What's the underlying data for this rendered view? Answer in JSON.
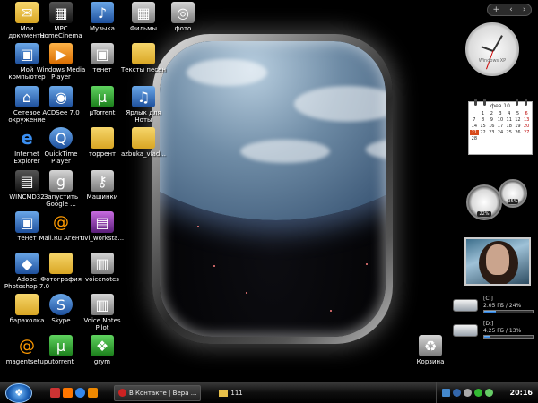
{
  "desktop": {
    "icons": [
      {
        "label": "Мои документы",
        "icon": "my-documents-icon"
      },
      {
        "label": "MPC HomeCinema",
        "icon": "mpc-icon"
      },
      {
        "label": "Музыка",
        "icon": "music-folder-icon"
      },
      {
        "label": "Фильмы",
        "icon": "films-icon"
      },
      {
        "label": "фото",
        "icon": "photo-icon"
      },
      {
        "label": "Мой компьютер",
        "icon": "my-computer-icon"
      },
      {
        "label": "Windows Media Player",
        "icon": "wmp-icon"
      },
      {
        "label": "тенет",
        "icon": "tenet-icon"
      },
      {
        "label": "Тексты песен",
        "icon": "folder-icon"
      },
      {
        "label": "Сетевое окружение",
        "icon": "network-icon"
      },
      {
        "label": "ACDSee 7.0",
        "icon": "acdsee-icon"
      },
      {
        "label": "µTorrent",
        "icon": "utorrent-icon"
      },
      {
        "label": "Ярлык для Ноты",
        "icon": "shortcut-icon"
      },
      {
        "label": "Internet Explorer",
        "icon": "ie-icon"
      },
      {
        "label": "QuickTime Player",
        "icon": "quicktime-icon"
      },
      {
        "label": "торрент",
        "icon": "folder-icon"
      },
      {
        "label": "azbuka_vlad...",
        "icon": "folder-icon"
      },
      {
        "label": "WINCMD32",
        "icon": "wincmd-icon"
      },
      {
        "label": "Запустить Google ...",
        "icon": "google-icon"
      },
      {
        "label": "Машинки",
        "icon": "cars-icon"
      },
      {
        "label": "тенет",
        "icon": "tenet-icon"
      },
      {
        "label": "Mail.Ru Агент",
        "icon": "mailru-icon"
      },
      {
        "label": "uvi_worksta...",
        "icon": "archive-icon"
      },
      {
        "label": "Adobe Photoshop 7.0",
        "icon": "photoshop-icon"
      },
      {
        "label": "Фотография",
        "icon": "folder-icon"
      },
      {
        "label": "voicenotes",
        "icon": "voicenotes-icon"
      },
      {
        "label": "барахолка",
        "icon": "folder-icon"
      },
      {
        "label": "Skype",
        "icon": "skype-icon"
      },
      {
        "label": "Voice Notes Pilot",
        "icon": "voicenotes-pilot-icon"
      },
      {
        "label": "magentsetup",
        "icon": "magent-icon"
      },
      {
        "label": "utorrent",
        "icon": "utorrent-icon"
      },
      {
        "label": "grym",
        "icon": "grym-icon"
      },
      {
        "label": "Корзина",
        "icon": "recycle-bin-icon"
      }
    ]
  },
  "sidebar": {
    "controls": [
      "+",
      "‹",
      "›"
    ],
    "clock": {
      "brand": "Windows XP"
    },
    "calendar": {
      "month": "фев 10",
      "days": [
        "",
        "1",
        "2",
        "3",
        "4",
        "5",
        "6",
        "7",
        "8",
        "9",
        "10",
        "11",
        "12",
        "13",
        "14",
        "15",
        "16",
        "17",
        "18",
        "19",
        "20",
        "21",
        "22",
        "23",
        "24",
        "25",
        "26",
        "27",
        "28"
      ],
      "today": "21"
    },
    "meters": {
      "cpu": "22%",
      "mem": "35%"
    },
    "drives": [
      {
        "name": "[C:]",
        "info": "2.05 ГБ / 24%",
        "fill": 0.24
      },
      {
        "name": "[D:]",
        "info": "4.25 ГБ / 13%",
        "fill": 0.13
      }
    ]
  },
  "taskbar": {
    "tasks": [
      {
        "label": "В Контакте | Вера ...",
        "icon": "browser-icon"
      },
      {
        "label": "111",
        "icon": "folder-icon"
      }
    ],
    "time": "20:16"
  },
  "colors": {
    "accent": "#1d6fd1",
    "taskbar": "#0e0e0e",
    "today": "#d84a1b"
  }
}
